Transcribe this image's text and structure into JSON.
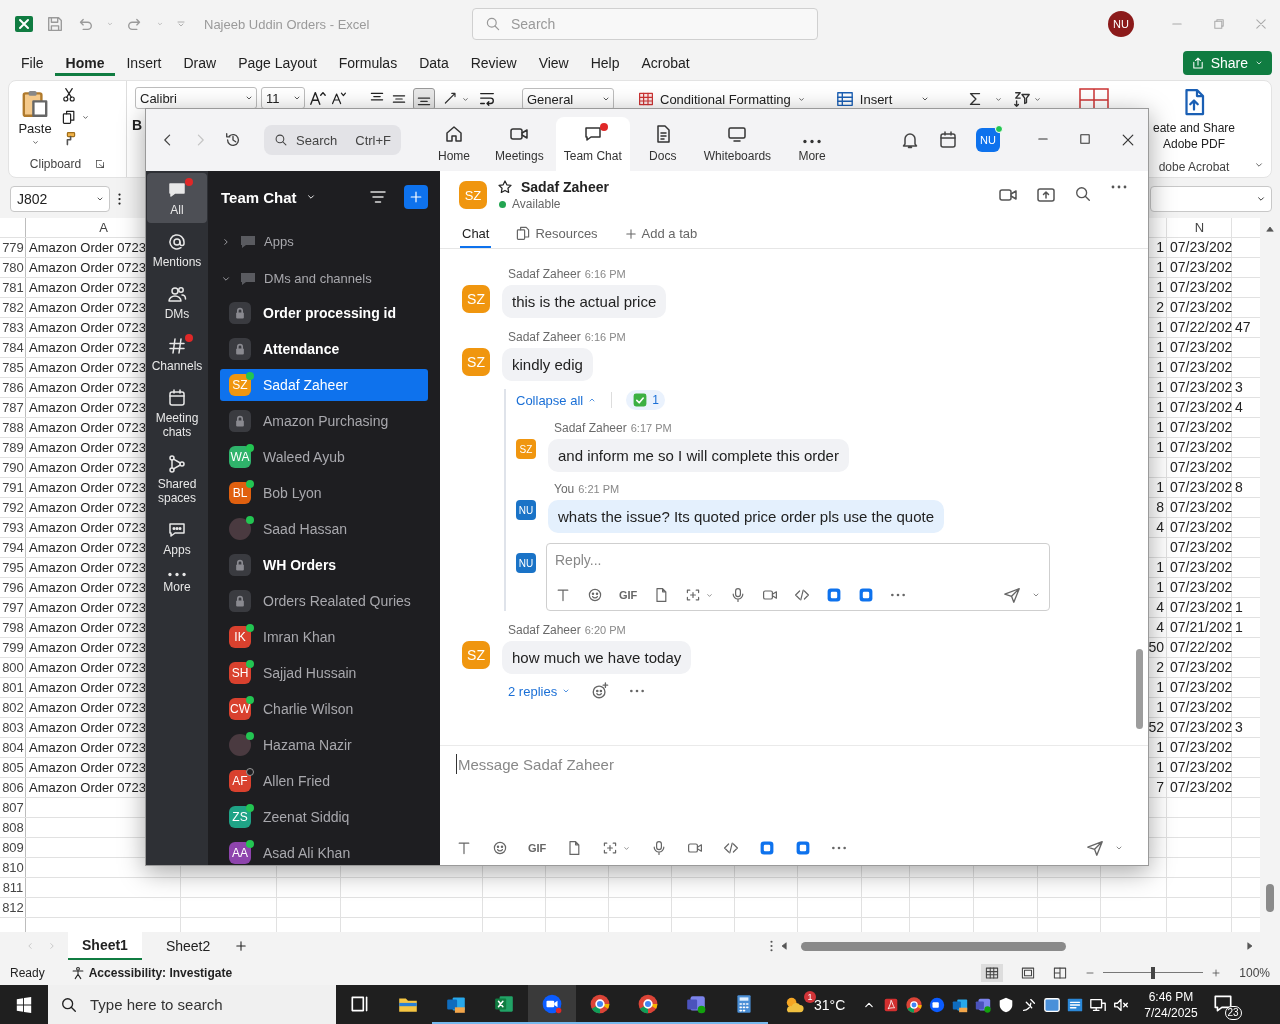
{
  "excel": {
    "title": "Najeeb Uddin Orders - Excel",
    "search_placeholder": "Search",
    "user_initials": "NU",
    "menu_tabs": [
      {
        "label": "File",
        "selected": false
      },
      {
        "label": "Home",
        "selected": true
      },
      {
        "label": "Insert",
        "selected": false
      },
      {
        "label": "Draw",
        "selected": false
      },
      {
        "label": "Page Layout",
        "selected": false
      },
      {
        "label": "Formulas",
        "selected": false
      },
      {
        "label": "Data",
        "selected": false
      },
      {
        "label": "Review",
        "selected": false
      },
      {
        "label": "View",
        "selected": false
      },
      {
        "label": "Help",
        "selected": false
      },
      {
        "label": "Acrobat",
        "selected": false
      }
    ],
    "share_button": "Share",
    "ribbon": {
      "paste": "Paste",
      "clipboard_group": "Clipboard",
      "font_name": "Calibri",
      "font_size": "11",
      "bold": "B",
      "number_format": "General",
      "conditional_formatting": "Conditional Formatting",
      "insert": "Insert",
      "acrobat_button": "eate and Share Adobe PDF",
      "acrobat_group": "dobe Acrobat"
    },
    "name_box": "J802",
    "column_headers": {
      "a": "A",
      "n": "N"
    },
    "rows": [
      {
        "row": "779",
        "a": "Amazon Order 0723",
        "m": "1",
        "n": "07/23/202"
      },
      {
        "row": "780",
        "a": "Amazon Order 0723",
        "m": "1",
        "n": "07/23/202"
      },
      {
        "row": "781",
        "a": "Amazon Order 0723",
        "m": "1",
        "n": "07/23/202"
      },
      {
        "row": "782",
        "a": "Amazon Order 0723",
        "m": "2",
        "n": "07/23/202"
      },
      {
        "row": "783",
        "a": "Amazon Order 0723",
        "m": "1",
        "n": "07/22/202",
        "o": "47"
      },
      {
        "row": "784",
        "a": "Amazon Order 0723",
        "m": "1",
        "n": "07/23/202"
      },
      {
        "row": "785",
        "a": "Amazon Order 0723",
        "m": "1",
        "n": "07/23/202"
      },
      {
        "row": "786",
        "a": "Amazon Order 0723",
        "m": "1",
        "n": "07/23/202",
        "o": "3"
      },
      {
        "row": "787",
        "a": "Amazon Order 0723",
        "m": "1",
        "n": "07/23/202",
        "o": "4"
      },
      {
        "row": "788",
        "a": "Amazon Order 0723",
        "m": "1",
        "n": "07/23/202"
      },
      {
        "row": "789",
        "a": "Amazon Order 0723",
        "m": "1",
        "n": "07/23/202"
      },
      {
        "row": "790",
        "a": "Amazon Order 0723",
        "n": "07/23/202"
      },
      {
        "row": "791",
        "a": "Amazon Order 0723",
        "m": "1",
        "n": "07/23/202",
        "o": "8"
      },
      {
        "row": "792",
        "a": "Amazon Order 0723",
        "m": "8",
        "n": "07/23/202"
      },
      {
        "row": "793",
        "a": "Amazon Order 0723",
        "m": "4",
        "n": "07/23/202"
      },
      {
        "row": "794",
        "a": "Amazon Order 0723",
        "n": "07/23/202"
      },
      {
        "row": "795",
        "a": "Amazon Order 0723",
        "m": "1",
        "n": "07/23/202"
      },
      {
        "row": "796",
        "a": "Amazon Order 0723",
        "m": "1",
        "n": "07/23/202"
      },
      {
        "row": "797",
        "a": "Amazon Order 0723",
        "m": "4",
        "n": "07/23/202",
        "o": "1"
      },
      {
        "row": "798",
        "a": "Amazon Order 0723",
        "m": "4",
        "n": "07/21/202",
        "o": "1"
      },
      {
        "row": "799",
        "a": "Amazon Order 0723",
        "m": "50",
        "n": "07/22/202"
      },
      {
        "row": "800",
        "a": "Amazon Order 0723",
        "m": "2",
        "n": "07/23/202"
      },
      {
        "row": "801",
        "a": "Amazon Order 0723",
        "m": "1",
        "n": "07/23/202"
      },
      {
        "row": "802",
        "a": "Amazon Order 0723",
        "m": "1",
        "n": "07/23/202"
      },
      {
        "row": "803",
        "a": "Amazon Order 0723",
        "m": "52",
        "n": "07/23/202",
        "o": "3"
      },
      {
        "row": "804",
        "a": "Amazon Order 0723",
        "m": "1",
        "n": "07/23/202"
      },
      {
        "row": "805",
        "a": "Amazon Order 0723",
        "m": "1",
        "n": "07/23/202"
      },
      {
        "row": "806",
        "a": "Amazon Order 0723",
        "m": "7",
        "n": "07/23/202"
      },
      {
        "row": "807"
      },
      {
        "row": "808"
      },
      {
        "row": "809"
      },
      {
        "row": "810"
      },
      {
        "row": "811"
      },
      {
        "row": "812"
      }
    ],
    "sheets": [
      {
        "label": "Sheet1",
        "selected": true
      },
      {
        "label": "Sheet2",
        "selected": false
      }
    ],
    "status": {
      "ready": "Ready",
      "accessibility": "Accessibility: Investigate",
      "zoom_slider": {
        "level": 0.5
      },
      "zoom_percent": "100%"
    }
  },
  "zoom": {
    "search": "Search",
    "search_shortcut": "Ctrl+F",
    "tabs": [
      {
        "label": "Home",
        "kind": "home",
        "selected": false,
        "notification": false
      },
      {
        "label": "Meetings",
        "kind": "meetings",
        "selected": false,
        "notification": false
      },
      {
        "label": "Team Chat",
        "kind": "chat",
        "selected": true,
        "notification": true
      },
      {
        "label": "Docs",
        "kind": "docs",
        "selected": false,
        "notification": false
      },
      {
        "label": "Whiteboards",
        "kind": "whiteboards",
        "selected": false,
        "notification": false
      },
      {
        "label": "More",
        "kind": "more",
        "selected": false,
        "notification": false
      }
    ],
    "user_initials": "NU",
    "user_online": true,
    "rail": [
      {
        "label": "All",
        "kind": "all",
        "selected": true,
        "notification": true
      },
      {
        "label": "Mentions",
        "kind": "mentions",
        "selected": false,
        "notification": false
      },
      {
        "label": "DMs",
        "kind": "dms",
        "selected": false,
        "notification": false
      },
      {
        "label": "Channels",
        "kind": "channels",
        "selected": false,
        "notification": true
      },
      {
        "label": "Meeting chats",
        "kind": "meeting_chats",
        "selected": false,
        "notification": false
      },
      {
        "label": "Shared spaces",
        "kind": "shared_spaces",
        "selected": false,
        "notification": false
      },
      {
        "label": "Apps",
        "kind": "apps",
        "selected": false,
        "notification": false
      },
      {
        "label": "More",
        "kind": "more",
        "selected": false,
        "notification": false
      }
    ],
    "sidebar": {
      "title": "Team Chat",
      "sections": [
        {
          "label": "Apps",
          "expanded": false
        },
        {
          "label": "DMs and channels",
          "expanded": true,
          "children": [
            {
              "kind": "channel",
              "name": "Order processing id",
              "unread": true,
              "selected": false
            },
            {
              "kind": "channel",
              "name": "Attendance",
              "unread": true,
              "selected": false
            },
            {
              "kind": "person",
              "name": "Sadaf Zaheer",
              "initials": "SZ",
              "color": "#f0960f",
              "online": true,
              "unread": false,
              "selected": true
            },
            {
              "kind": "channel",
              "name": "Amazon Purchasing",
              "unread": false,
              "selected": false
            },
            {
              "kind": "person",
              "name": "Waleed Ayub",
              "initials": "WA",
              "color": "#2fb36b",
              "online": true,
              "unread": false,
              "selected": false
            },
            {
              "kind": "person",
              "name": "Bob Lyon",
              "initials": "BL",
              "color": "#e0600f",
              "online": true,
              "unread": false,
              "selected": false
            },
            {
              "kind": "photo",
              "name": "Saad Hassan",
              "online": true,
              "unread": false,
              "selected": false
            },
            {
              "kind": "channel",
              "name": "WH Orders",
              "unread": true,
              "selected": false
            },
            {
              "kind": "channel",
              "name": "Orders Realated Quries",
              "unread": false,
              "selected": false
            },
            {
              "kind": "person",
              "name": "Imran Khan",
              "initials": "IK",
              "color": "#d9412e",
              "online": true,
              "unread": false,
              "selected": false
            },
            {
              "kind": "person",
              "name": "Sajjad Hussain",
              "initials": "SH",
              "color": "#d9412e",
              "online": true,
              "unread": false,
              "selected": false
            },
            {
              "kind": "person",
              "name": "Charlie Wilson",
              "initials": "CW",
              "color": "#d9412e",
              "online": true,
              "unread": false,
              "selected": false
            },
            {
              "kind": "photo",
              "name": "Hazama Nazir",
              "online": true,
              "unread": false,
              "selected": false
            },
            {
              "kind": "person",
              "name": "Allen Fried",
              "initials": "AF",
              "color": "#d9412e",
              "online": false,
              "unread": false,
              "selected": false
            },
            {
              "kind": "person",
              "name": "Zeenat Siddiq",
              "initials": "ZS",
              "color": "#1fa386",
              "online": true,
              "unread": false,
              "selected": false
            },
            {
              "kind": "person",
              "name": "Asad Ali Khan",
              "initials": "AA",
              "color": "#8e44ad",
              "online": true,
              "unread": false,
              "selected": false
            }
          ]
        }
      ]
    },
    "chat": {
      "initials": "SZ",
      "name": "Sadaf Zaheer",
      "status": "Available",
      "tabs": [
        {
          "label": "Chat",
          "kind": "chat",
          "selected": true
        },
        {
          "label": "Resources",
          "kind": "resources",
          "selected": false
        },
        {
          "label": "Add a tab",
          "kind": "add",
          "selected": false
        }
      ],
      "messages": [
        {
          "sender": "Sadaf Zaheer",
          "time": "6:16 PM",
          "initials": "SZ",
          "mine": false,
          "text": "this is the actual price"
        },
        {
          "sender": "Sadaf Zaheer",
          "time": "6:16 PM",
          "initials": "SZ",
          "mine": false,
          "text": "kindly edig",
          "thread": {
            "collapse": "Collapse all",
            "reaction_count": "1",
            "replies": [
              {
                "sender": "Sadaf Zaheer",
                "time": "6:17 PM",
                "initials": "SZ",
                "mine": false,
                "text": "and inform me so I will complete this order"
              },
              {
                "sender": "You",
                "time": "6:21 PM",
                "initials": "NU",
                "mine": true,
                "text": "whats the issue? Its quoted price order pls use the quote"
              }
            ],
            "reply_initials": "NU",
            "reply_placeholder": "Reply...",
            "reply_gif": "GIF"
          }
        },
        {
          "sender": "Sadaf Zaheer",
          "time": "6:20 PM",
          "initials": "SZ",
          "mine": false,
          "text": "how much we have today",
          "replies_link": "2 replies"
        }
      ],
      "composer_placeholder": "Message Sadaf Zaheer",
      "composer_gif": "GIF"
    }
  },
  "taskbar": {
    "search_placeholder": "Type here to search",
    "apps": [
      {
        "kind": "task_view",
        "running": false,
        "active": false
      },
      {
        "kind": "explorer",
        "running": false,
        "active": false
      },
      {
        "kind": "outlook",
        "running": true,
        "active": false
      },
      {
        "kind": "excel",
        "running": true,
        "active": false
      },
      {
        "kind": "zoom",
        "running": true,
        "active": true
      },
      {
        "kind": "chrome",
        "running": true,
        "active": false
      },
      {
        "kind": "chrome",
        "running": true,
        "active": false
      },
      {
        "kind": "teams",
        "running": true,
        "active": false
      },
      {
        "kind": "calculator",
        "running": true,
        "active": false
      }
    ],
    "weather_badge": "1",
    "temperature": "31°C",
    "time": "6:46 PM",
    "date": "7/24/2025",
    "notification_count": "23"
  }
}
